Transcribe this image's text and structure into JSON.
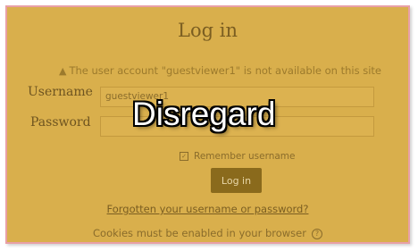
{
  "login": {
    "title": "Log in",
    "warning_text": "The user account \"guestviewer1\" is not available on this site",
    "warning_icon": "warning-triangle-icon",
    "username_label": "Username",
    "username_value": "guestviewer1",
    "password_label": "Password",
    "password_value": "",
    "remember_label": "Remember username",
    "remember_checked": true,
    "button_label": "Log in",
    "forgot_link": "Forgotten your username or password?",
    "cookies_note": "Cookies must be enabled in your browser",
    "help_icon": "help-circle-icon"
  },
  "overlay": {
    "text": "Disregard"
  },
  "colors": {
    "panel_background": "#d9af4c",
    "panel_border": "#e8a0a6",
    "button_background": "#8a6a1c",
    "text": "#7b5e21"
  }
}
